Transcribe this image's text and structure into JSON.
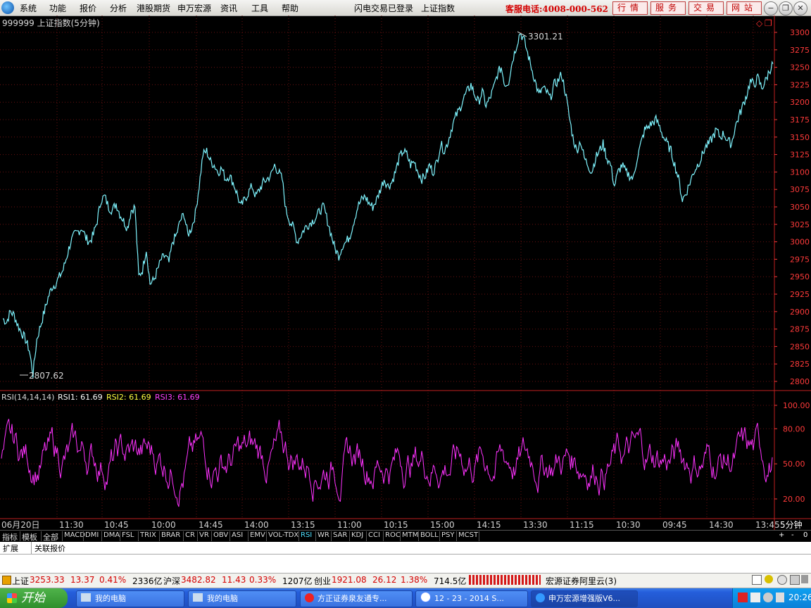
{
  "menu": {
    "items": [
      "系统",
      "功能",
      "报价",
      "分析",
      "港股期货",
      "申万宏源",
      "资讯",
      "工具",
      "帮助"
    ],
    "login_status": "闪电交易已登录",
    "index_name": "上证指数",
    "hotline": "客服电话:4008-000-562",
    "right_buttons": [
      "行情",
      "服务",
      "交易",
      "网站"
    ]
  },
  "chart": {
    "title": "999999 上证指数(5分钟)",
    "price_labels": [
      "3300",
      "3275",
      "3250",
      "3225",
      "3200",
      "3175",
      "3150",
      "3125",
      "3100",
      "3075",
      "3050",
      "3025",
      "3000",
      "2975",
      "2950",
      "2925",
      "2900",
      "2875",
      "2850",
      "2825",
      "2800"
    ],
    "high_label": "3301.21",
    "low_label": "2807.62",
    "rsi_header": {
      "name": "RSI(14,14,14)",
      "rsi1": "RSI1: 61.69",
      "rsi2": "RSI2: 61.69",
      "rsi3": "RSI3: 61.69"
    },
    "rsi_labels": [
      "100.00",
      "80.00",
      "50.00",
      "20.00"
    ],
    "time_labels": [
      "06月20日",
      "11:30",
      "10:45",
      "10:00",
      "14:45",
      "14:00",
      "13:15",
      "11:00",
      "10:15",
      "15:00",
      "14:15",
      "13:30",
      "11:15",
      "10:30",
      "09:45",
      "14:30",
      "13:45"
    ],
    "period_label": "5分钟",
    "colors": {
      "price": "#7ff5ff",
      "rsi": "#ff32ff",
      "axis": "#ff3a3a",
      "grid": "#6a1010"
    }
  },
  "chart_data": {
    "type": "line",
    "title": "999999 上证指数(5分钟)",
    "series": [
      {
        "name": "",
        "approx_values": [
          2890,
          2885,
          2900,
          2895,
          2880,
          2870,
          2860,
          2845,
          2810,
          2860,
          2880,
          2900,
          2920,
          2935,
          2940,
          2950,
          2960,
          2980,
          3000,
          3010,
          3015,
          3020,
          3005,
          3000,
          3010,
          3030,
          3060,
          3065,
          3050,
          3045,
          3055,
          3040,
          3030,
          3020,
          3045,
          3050,
          2950,
          2960,
          2990,
          2940,
          2945,
          2960,
          2975,
          2980,
          2970,
          3000,
          3010,
          3030,
          3040,
          3010,
          3020,
          3040,
          3080,
          3125,
          3130,
          3115,
          3110,
          3100,
          3105,
          3090,
          3095,
          3085,
          3070,
          3050,
          3060,
          3070,
          3080,
          3065,
          3075,
          3085,
          3090,
          3095,
          3110,
          3100,
          3090,
          3045,
          3030,
          3020,
          3000,
          3010,
          3020,
          3025,
          3030,
          3035,
          3045,
          3050,
          3030,
          3010,
          2990,
          2980,
          2995,
          3000,
          3010,
          3030,
          3050,
          3060,
          3065,
          3055,
          3050,
          3060,
          3075,
          3090,
          3080,
          3085,
          3100,
          3120,
          3130,
          3125,
          3110,
          3115,
          3100,
          3090,
          3095,
          3110,
          3100,
          3115,
          3140,
          3130,
          3145,
          3165,
          3180,
          3190,
          3205,
          3215,
          3225,
          3210,
          3200,
          3215,
          3195,
          3205,
          3220,
          3240,
          3250,
          3225,
          3230,
          3260,
          3280,
          3300,
          3290,
          3270,
          3250,
          3230,
          3210,
          3220,
          3215,
          3205,
          3225,
          3230,
          3240,
          3215,
          3180,
          3150,
          3130,
          3145,
          3120,
          3110,
          3100,
          3120,
          3130,
          3140,
          3120,
          3110,
          3080,
          3100,
          3110,
          3100,
          3095,
          3090,
          3120,
          3140,
          3160,
          3165,
          3170,
          3175,
          3165,
          3150,
          3140,
          3130,
          3110,
          3090,
          3060,
          3070,
          3085,
          3100,
          3110,
          3120,
          3135,
          3140,
          3150,
          3160,
          3150,
          3155,
          3145,
          3140,
          3165,
          3180,
          3195,
          3210,
          3230,
          3225,
          3235,
          3220,
          3230,
          3245,
          3255
        ]
      }
    ],
    "xlabel": "",
    "ylabel": "",
    "ylim": [
      2795,
      3305
    ],
    "grid": true
  },
  "indicator_tabs": [
    "指标",
    "模板",
    "全部",
    "MACD",
    "DMI",
    "DMA",
    "FSL",
    "TRIX",
    "BRAR",
    "CR",
    "VR",
    "OBV",
    "ASI",
    "EMV",
    "VOL-TDX",
    "RSI",
    "WR",
    "SAR",
    "KDJ",
    "CCI",
    "ROC",
    "MTM",
    "BOLL",
    "PSY",
    "MCST"
  ],
  "indicator_active": "RSI",
  "tab_controls": [
    "+",
    "-",
    "0"
  ],
  "sub_tabs": [
    "扩展\u001c",
    "关联报价"
  ],
  "ticker": {
    "sh_label": "上证",
    "sh_price": "3253.33",
    "sh_change": "13.37",
    "sh_pct": "0.41%",
    "sh_amount": "2336亿",
    "hs_label": "沪深",
    "hs_price": "3482.82",
    "hs_change": "11.43",
    "hs_pct": "0.33%",
    "hs_amount": "1207亿",
    "cy_label": "创业",
    "cy_price": "1921.08",
    "cy_change": "26.12",
    "cy_pct": "1.38%",
    "cy_amount": "714.5亿",
    "server": "宏源证券阿里云(3)"
  },
  "taskbar": {
    "start": "开始",
    "tasks": [
      "我的电脑",
      "我的电脑",
      "方正证券泉友通专...",
      "12 - 23 - 2014 S...",
      "申万宏源增强版V6..."
    ],
    "clock": "20:26"
  }
}
